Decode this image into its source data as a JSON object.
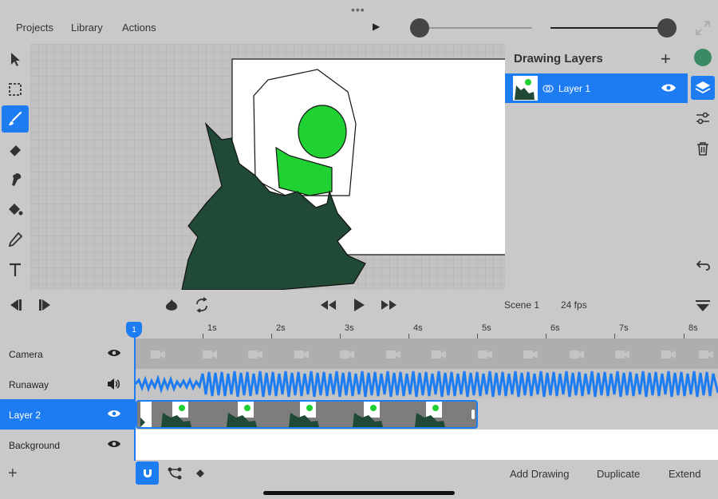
{
  "menu": {
    "projects": "Projects",
    "library": "Library",
    "actions": "Actions"
  },
  "top_controls": {
    "brush_size_level": 0.05,
    "brush_opacity_level": 1.0,
    "color_current": "#3a8a66"
  },
  "layers_panel": {
    "title": "Drawing Layers",
    "layers": [
      {
        "name": "Layer 1",
        "visible": true,
        "selected": true
      }
    ]
  },
  "playback": {
    "scene": "Scene 1",
    "fps": "24 fps"
  },
  "timeline": {
    "current_frame": "1",
    "ticks": [
      "1s",
      "2s",
      "3s",
      "4s",
      "5s",
      "6s",
      "7s",
      "8s"
    ],
    "tracks": [
      {
        "name": "Camera",
        "icon": "eye-icon"
      },
      {
        "name": "Runaway",
        "icon": "speaker-icon"
      },
      {
        "name": "Layer 2",
        "icon": "eye-icon",
        "active": true
      },
      {
        "name": "Background",
        "icon": "eye-icon"
      }
    ]
  },
  "bottom_actions": {
    "add_drawing": "Add Drawing",
    "duplicate": "Duplicate",
    "extend": "Extend"
  },
  "colors": {
    "accent": "#1e7cf2",
    "fill_dark_green": "#214a36",
    "fill_bright_green": "#1fd132"
  }
}
